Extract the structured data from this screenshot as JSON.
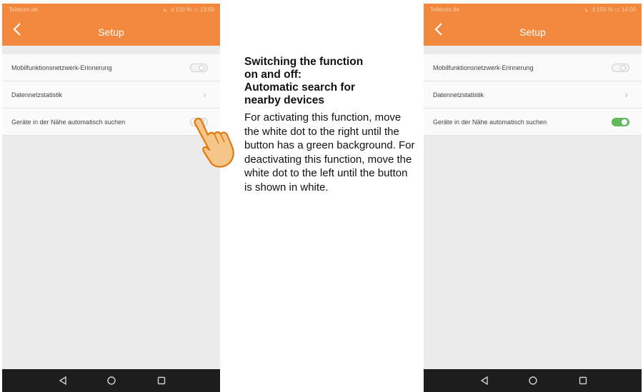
{
  "left_phone": {
    "status_bar": {
      "carrier": "Telekom.de",
      "system_info": "⊾ .ıl 100 % ▭ 13:59"
    },
    "title": "Setup",
    "settings": [
      {
        "label": "Mobilfunktionsnetzwerk-Erinnerung",
        "control": "toggle",
        "state": "off"
      },
      {
        "label": "Datennetzstatistik",
        "control": "chevron",
        "glyph": "›"
      },
      {
        "label": "Geräte in der Nähe automatisch suchen",
        "control": "toggle",
        "state": "off"
      }
    ]
  },
  "right_phone": {
    "status_bar": {
      "carrier": "Telekom.de",
      "system_info": "⊾ .ıl 100 % ▭ 14:00"
    },
    "title": "Setup",
    "settings": [
      {
        "label": "Mobilfunktionsnetzwerk-Erinnerung",
        "control": "toggle",
        "state": "off"
      },
      {
        "label": "Datennetzstatistik",
        "control": "chevron",
        "glyph": "›"
      },
      {
        "label": "Geräte in der Nähe automatisch suchen",
        "control": "toggle",
        "state": "on"
      }
    ]
  },
  "instructions": {
    "heading_line1": "Switching the function",
    "heading_line2": "on and off:",
    "heading_line3": "Automatic search for",
    "heading_line4": "nearby devices",
    "body": "For activating this function, move the white dot to the right until the button has a green background. For deactivating this function, move the white dot to the left until the button is shown in white."
  },
  "colors": {
    "header_orange": "#f1883e",
    "toggle_on_green": "#62b85a",
    "nav_bar_dark": "#1d1d1d",
    "hand_fill": "#f6c58a",
    "hand_outline": "#e07a10"
  },
  "icons": [
    "back-arrow-icon",
    "chevron-right-icon",
    "nav-back-icon",
    "nav-home-icon",
    "nav-recents-icon",
    "pointing-hand-icon"
  ]
}
